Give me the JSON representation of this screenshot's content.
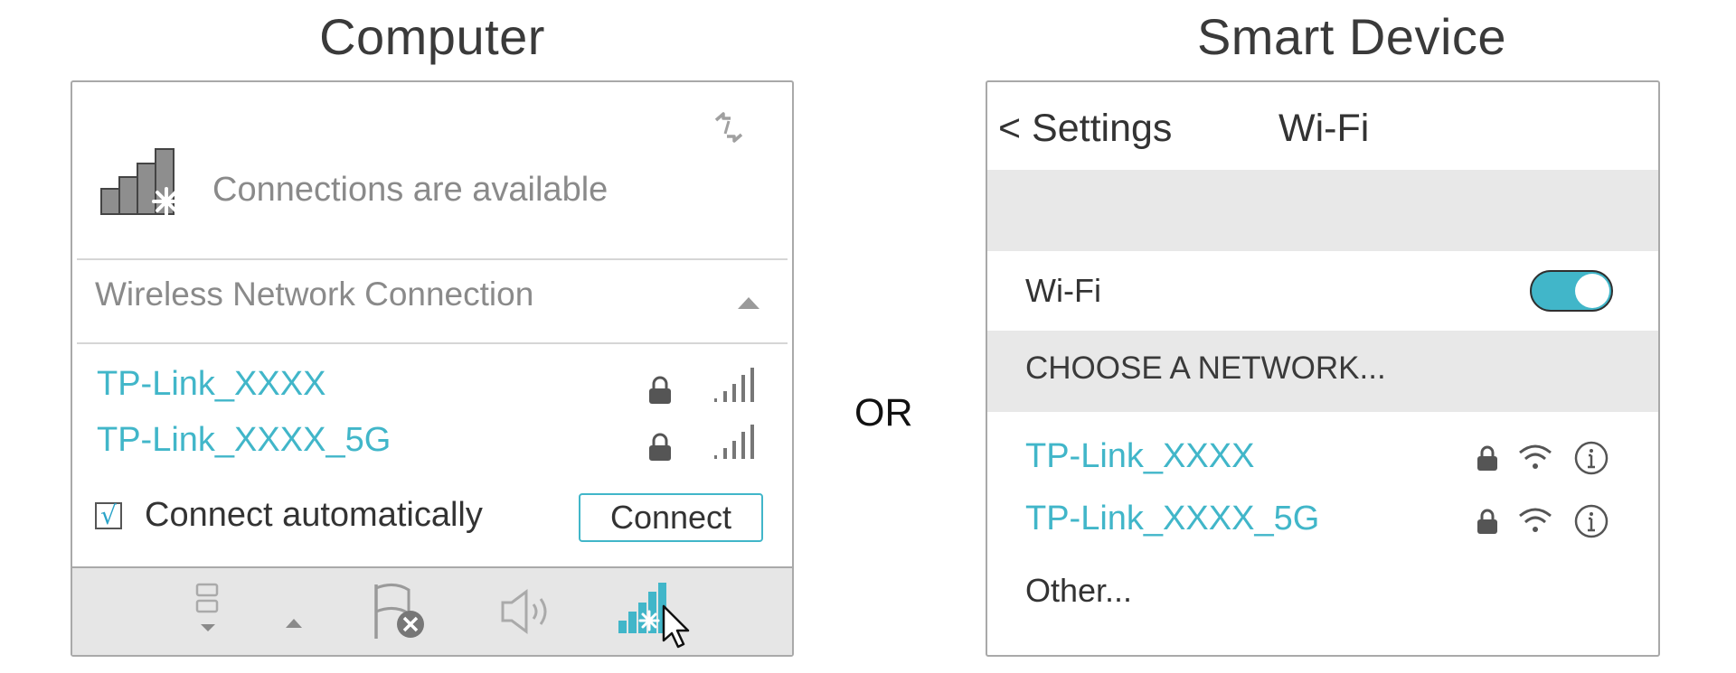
{
  "computer": {
    "title": "Computer",
    "status": "Connections are available",
    "connection_label": "Wireless Network Connection",
    "networks": [
      {
        "ssid": "TP-Link_XXXX",
        "secured": true,
        "signal_bars": 4
      },
      {
        "ssid": "TP-Link_XXXX_5G",
        "secured": true,
        "signal_bars": 4
      }
    ],
    "auto_connect_checkmark": "√",
    "auto_connect_label": "Connect automatically",
    "auto_connect_checked": true,
    "connect_button": "Connect",
    "taskbar_icons": [
      "network-devices-icon",
      "show-hidden-icons-arrow",
      "action-center-flag-icon",
      "speaker-icon",
      "wifi-available-tray-icon"
    ]
  },
  "divider_label": "OR",
  "smart_device": {
    "title": "Smart Device",
    "back_label": "< Settings",
    "header_title": "Wi-Fi",
    "wifi_label": "Wi-Fi",
    "wifi_enabled": true,
    "choose_label": "CHOOSE A NETWORK...",
    "networks": [
      {
        "ssid": "TP-Link_XXXX",
        "secured": true
      },
      {
        "ssid": "TP-Link_XXXX_5G",
        "secured": true
      }
    ],
    "other_label": "Other..."
  },
  "colors": {
    "accent": "#41b6c9",
    "panel_border": "#a9a9a9",
    "section_gray": "#e8e8e8",
    "muted_text": "#8a8a8a"
  }
}
